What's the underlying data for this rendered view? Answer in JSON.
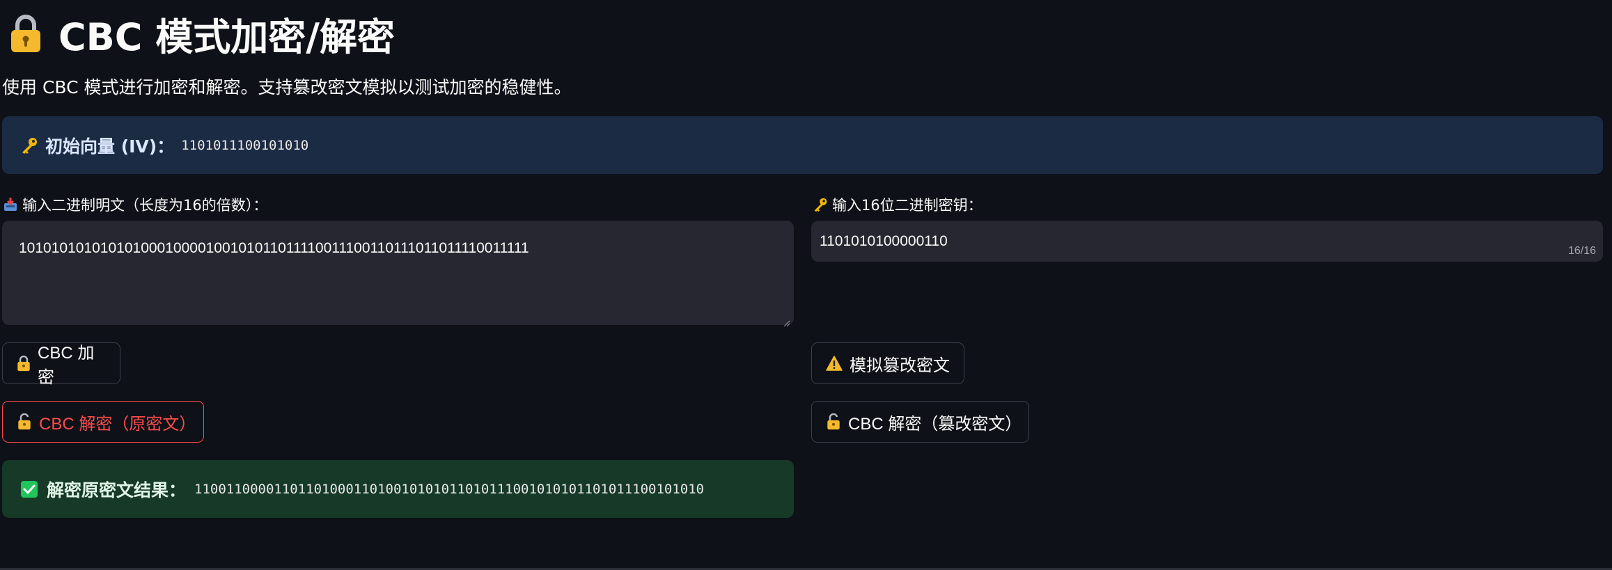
{
  "header": {
    "title": "CBC 模式加密/解密",
    "title_icon": "lock-icon",
    "subtitle": "使用 CBC 模式进行加密和解密。支持篡改密文模拟以测试加密的稳健性。"
  },
  "iv": {
    "label": "初始向量 (IV)：",
    "value": "1101011100101010",
    "icon": "key-icon",
    "bg_color": "#1c2b44"
  },
  "plaintext": {
    "label": "输入二进制明文（长度为16的倍数）：",
    "icon": "inbox-tray-icon",
    "value": "10101010101010100010000100101011011110011100110111011011110011111"
  },
  "key": {
    "label": "输入16位二进制密钥：",
    "icon": "key-icon",
    "value": "1101010100000110",
    "counter": "16/16"
  },
  "buttons": {
    "encrypt": "CBC 加密",
    "tamper": "模拟篡改密文",
    "decrypt_original": "CBC 解密（原密文）",
    "decrypt_tampered": "CBC 解密（篡改密文）"
  },
  "result": {
    "label": "解密原密文结果：",
    "value": "1100110000110110100011010010101011010111001010101101011100101010",
    "bg_color": "#173928",
    "icon": "check-box-icon"
  },
  "colors": {
    "background": "#0e1117",
    "input_bg": "#262730",
    "accent_red": "#ff4b4b",
    "lock_gold": "#f5b92e"
  }
}
